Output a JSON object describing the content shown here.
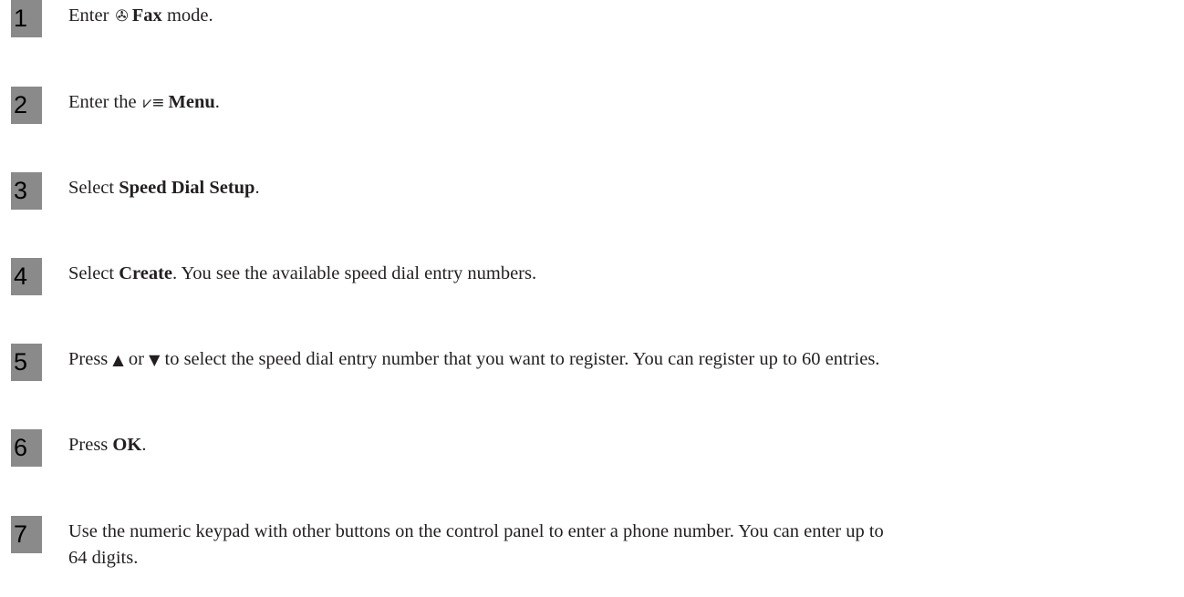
{
  "steps": [
    {
      "number": "1",
      "pre": "Enter",
      "icon": "fax-icon",
      "glyph": "✇",
      "bold": "Fax",
      "post": "mode."
    },
    {
      "number": "2",
      "pre": "Enter the",
      "icon": "menu-icon",
      "glyph": "⩗≡",
      "bold": "Menu",
      "post": "."
    },
    {
      "number": "3",
      "pre": "Select",
      "bold": "Speed Dial Setup",
      "post": "."
    },
    {
      "number": "4",
      "pre": "Select",
      "bold": "Create",
      "post": ". You see the available speed dial entry numbers."
    },
    {
      "number": "5",
      "pre": "Press",
      "up": "▲",
      "mid": "or",
      "down": "▼",
      "post": "to select the speed dial entry number that you want to register. You can register up to 60 entries."
    },
    {
      "number": "6",
      "pre": "Press",
      "bold": "OK",
      "post": "."
    },
    {
      "number": "7",
      "line1": "Use the numeric keypad with other buttons on the control panel to enter a phone number. You can enter up to",
      "line2": "64 digits."
    }
  ]
}
